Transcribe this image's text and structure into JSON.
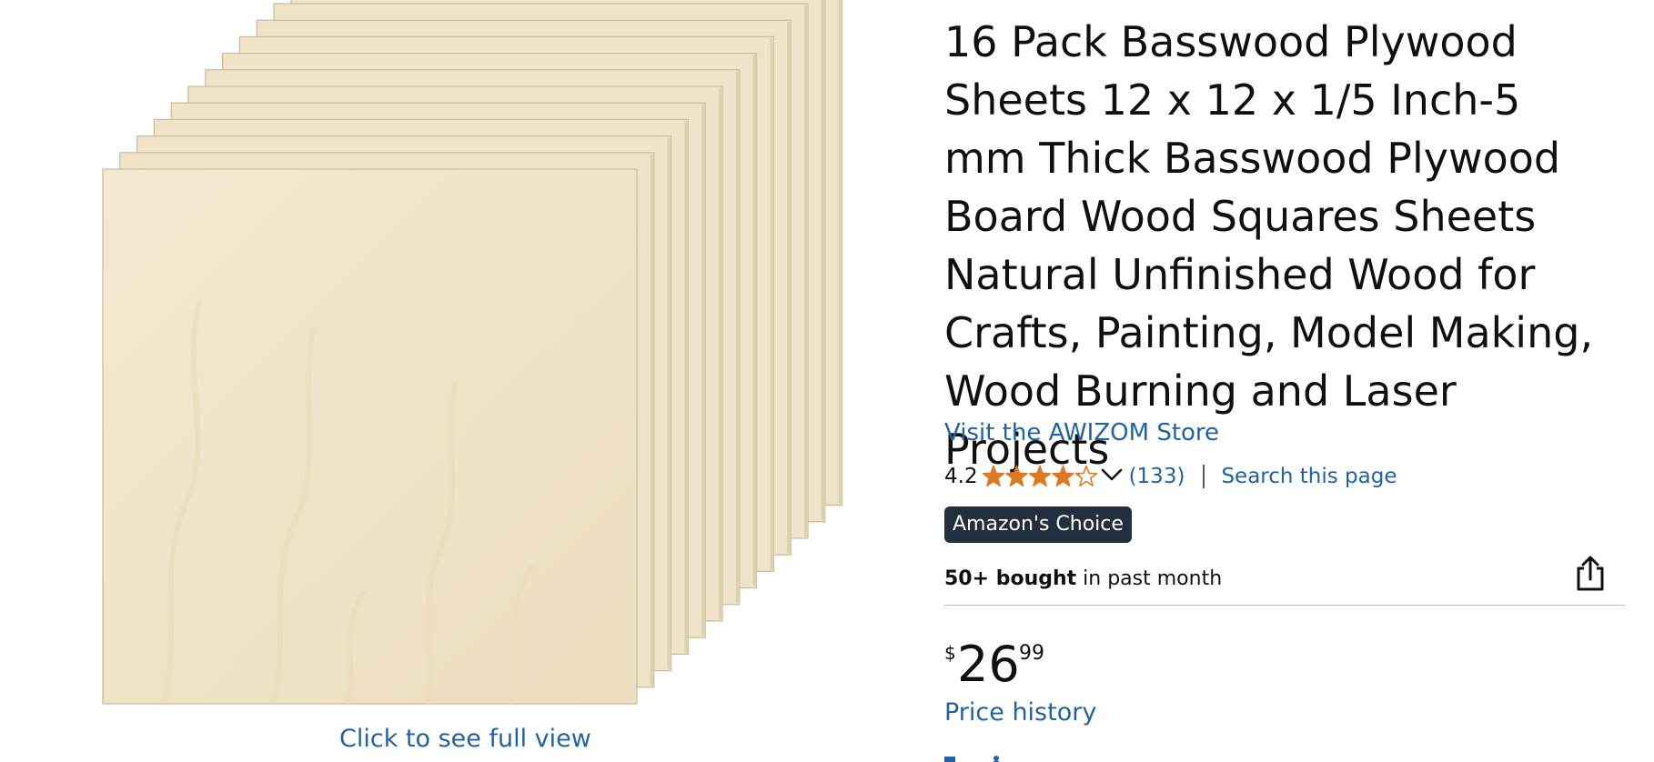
{
  "image": {
    "full_view_label": "Click to see full view"
  },
  "product": {
    "title": "16 Pack Basswood Plywood Sheets 12 x 12 x 1/5 Inch-5 mm Thick Basswood Plywood Board Wood Squares Sheets Natural Unfinished Wood for Crafts, Painting, Model Making, Wood Burning and Laser Projects",
    "store_link": "Visit the AWIZOM Store",
    "rating": {
      "value": "4.2",
      "stars": 4.2,
      "max_stars": 5,
      "count": "(133)",
      "search_label": "Search this page"
    },
    "badge": "Amazon's Choice",
    "bought": {
      "bold": "50+ bought",
      "rest": " in past month"
    },
    "price": {
      "symbol": "$",
      "whole": "26",
      "fraction": "99"
    },
    "price_history": "Price history"
  },
  "icons": {
    "share": "share-icon",
    "chevron": "chevron-down-icon",
    "star": "star-icon"
  },
  "colors": {
    "link": "#2162a1",
    "star": "#de7921",
    "badge_bg": "#232f3e",
    "text": "#0f1111",
    "wood": "#f1e6cb"
  }
}
